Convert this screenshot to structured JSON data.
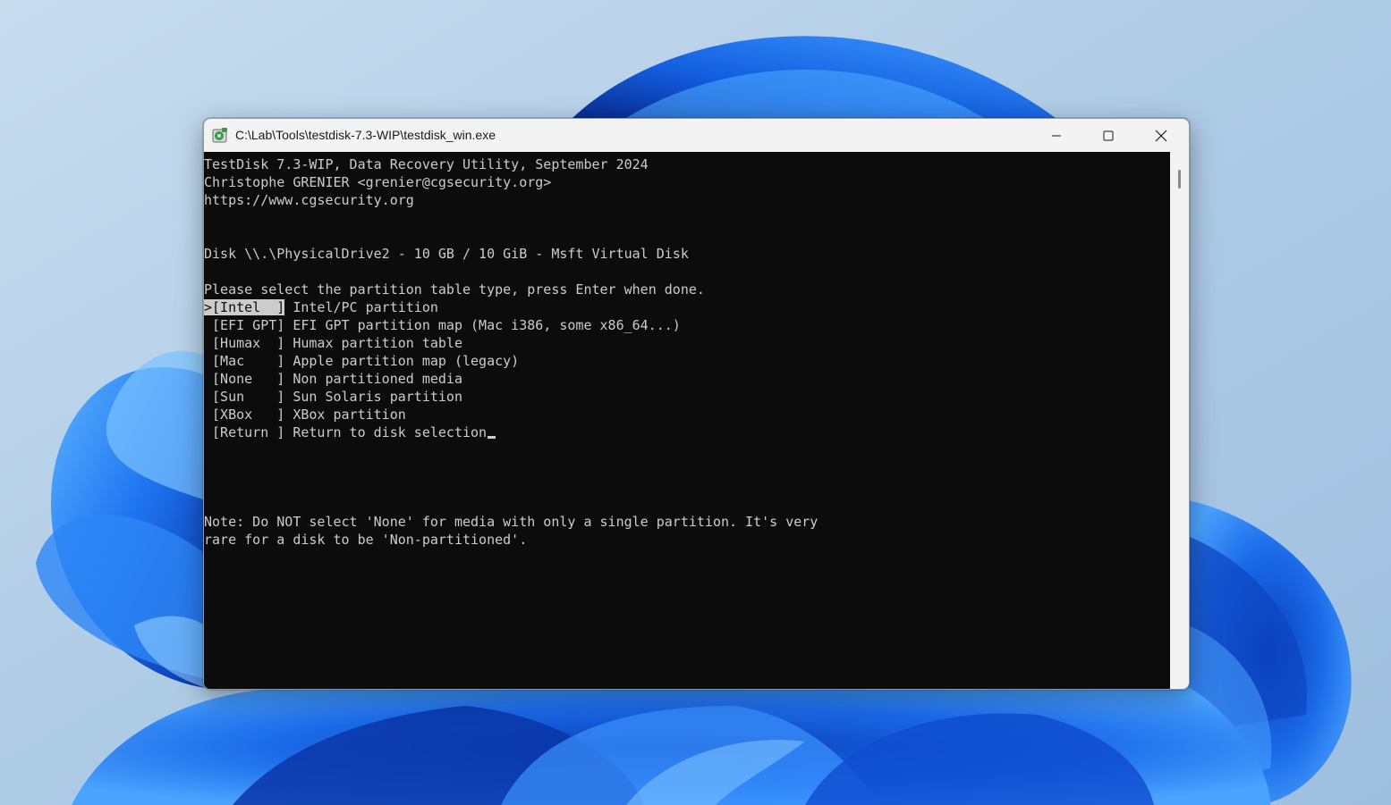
{
  "window": {
    "title": "C:\\Lab\\Tools\\testdisk-7.3-WIP\\testdisk_win.exe",
    "app_icon": "testdisk-app-icon",
    "controls": {
      "minimize_icon": "minimize-icon",
      "maximize_icon": "maximize-icon",
      "close_icon": "close-icon"
    }
  },
  "console": {
    "header": [
      "TestDisk 7.3-WIP, Data Recovery Utility, September 2024",
      "Christophe GRENIER <grenier@cgsecurity.org>",
      "https://www.cgsecurity.org"
    ],
    "disk_line": "Disk \\\\.\\PhysicalDrive2 - 10 GB / 10 GiB - Msft Virtual Disk",
    "prompt": "Please select the partition table type, press Enter when done.",
    "selected_index": 0,
    "options": [
      {
        "pointer": ">",
        "key": "[Intel  ]",
        "description": " Intel/PC partition"
      },
      {
        "pointer": " ",
        "key": "[EFI GPT]",
        "description": " EFI GPT partition map (Mac i386, some x86_64...)"
      },
      {
        "pointer": " ",
        "key": "[Humax  ]",
        "description": " Humax partition table"
      },
      {
        "pointer": " ",
        "key": "[Mac    ]",
        "description": " Apple partition map (legacy)"
      },
      {
        "pointer": " ",
        "key": "[None   ]",
        "description": " Non partitioned media"
      },
      {
        "pointer": " ",
        "key": "[Sun    ]",
        "description": " Sun Solaris partition"
      },
      {
        "pointer": " ",
        "key": "[XBox   ]",
        "description": " XBox partition"
      },
      {
        "pointer": " ",
        "key": "[Return ]",
        "description": " Return to disk selection"
      }
    ],
    "note": [
      "Note: Do NOT select 'None' for media with only a single partition. It's very",
      "rare for a disk to be 'Non-partitioned'."
    ]
  },
  "colors": {
    "console_bg": "#0c0c0c",
    "console_fg": "#cccccc",
    "titlebar_bg": "#f3f3f3",
    "wallpaper_blue": "#1a5fd6"
  }
}
